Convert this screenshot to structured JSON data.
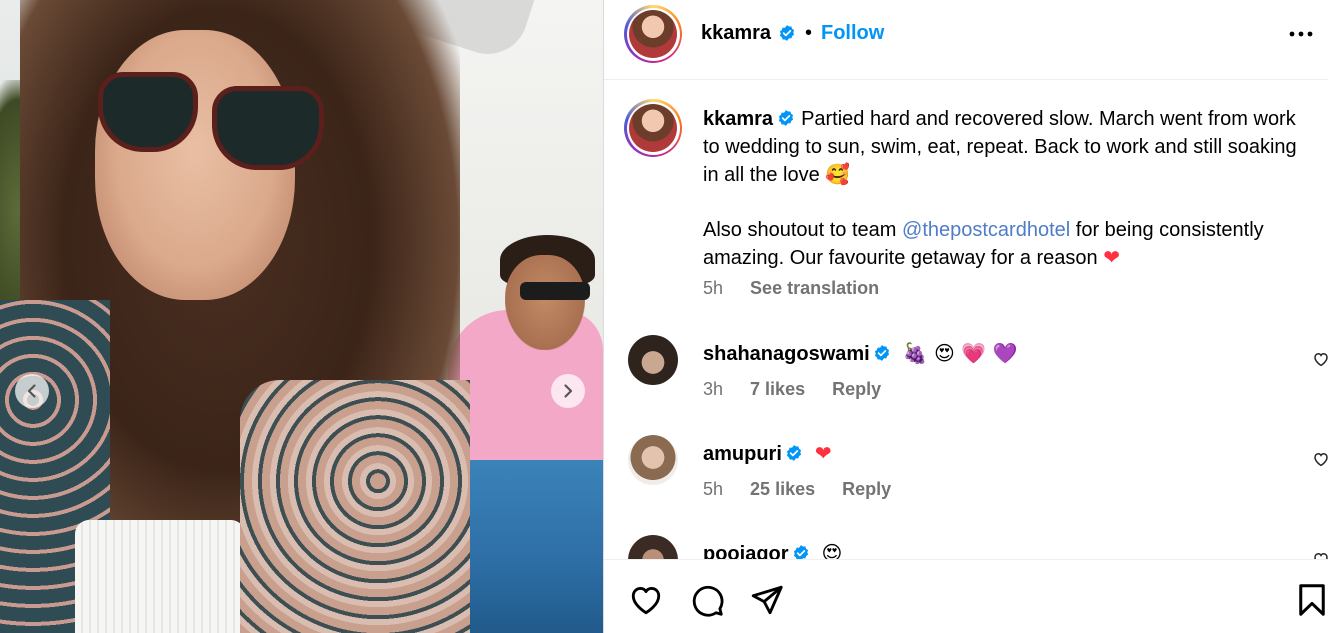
{
  "post": {
    "username": "kkamra",
    "follow_label": "Follow",
    "separator": "•"
  },
  "caption": {
    "username": "kkamra",
    "text_1": "Partied hard and recovered slow. March went from work to wedding to sun, swim, eat, repeat. Back to work and still soaking in all the love",
    "emoji_1": "🥰",
    "text_2_before": "Also shoutout to team ",
    "mention": "@thepostcardhotel",
    "text_2_after": " for being consistently amazing. Our favourite getaway for a reason",
    "emoji_2": "❤",
    "time": "5h",
    "see_translation": "See translation"
  },
  "comments": [
    {
      "username": "shahanagoswami",
      "text": "🍇 😍 💗 💜",
      "time": "3h",
      "likes": "7 likes",
      "reply": "Reply"
    },
    {
      "username": "amupuri",
      "text": "❤",
      "time": "5h",
      "likes": "25 likes",
      "reply": "Reply"
    },
    {
      "username": "poojagor",
      "text": "😍",
      "time": "",
      "likes": "",
      "reply": ""
    }
  ],
  "icons": {
    "verified": "verified-badge-icon",
    "more": "more-options-icon",
    "like": "heart-icon",
    "comment": "comment-icon",
    "share": "share-icon",
    "save": "bookmark-icon",
    "prev": "chevron-left-icon",
    "next": "chevron-right-icon"
  },
  "colors": {
    "accent": "#0095f6",
    "verified": "#0095f6",
    "heart_red": "#ff3040",
    "secondary_text": "#737373"
  }
}
